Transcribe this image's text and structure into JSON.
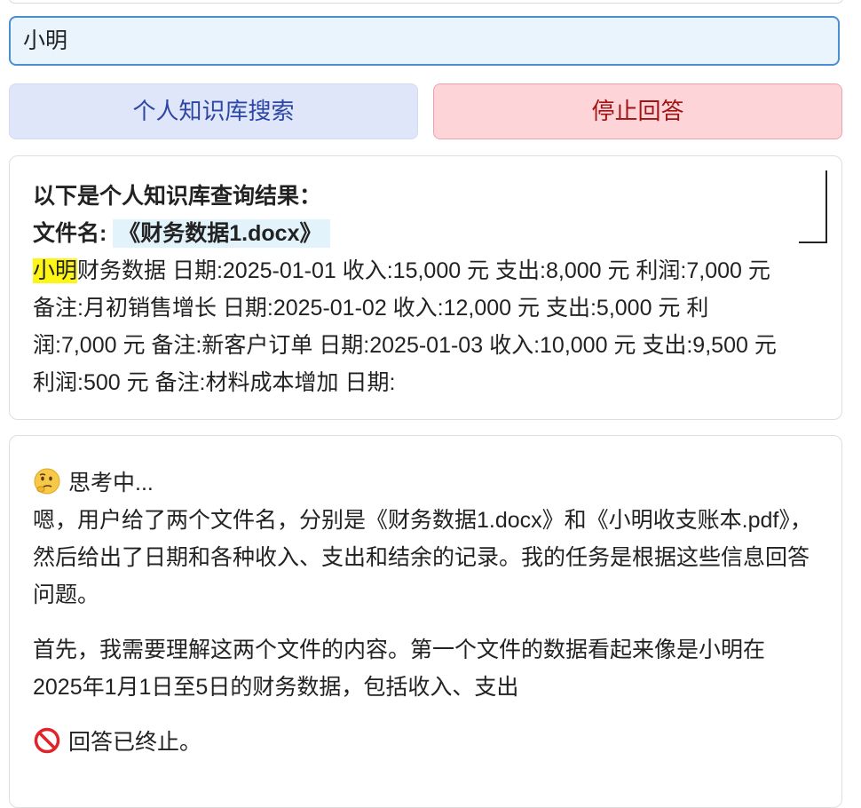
{
  "search": {
    "value": "小明"
  },
  "buttons": {
    "search_label": "个人知识库搜索",
    "stop_label": "停止回答"
  },
  "result": {
    "heading": "以下是个人知识库查询结果：",
    "filename_label": "文件名:",
    "filename": "《财务数据1.docx》",
    "highlight_term": "小明",
    "content": "财务数据 日期:2025-01-01 收入:15,000 元 支出:8,000 元 利润:7,000 元 备注:月初销售增长 日期:2025-01-02 收入:12,000 元 支出:5,000 元 利润:7,000 元 备注:新客户订单 日期:2025-01-03 收入:10,000 元 支出:9,500 元 利润:500 元 备注:材料成本增加 日期:"
  },
  "answer": {
    "thinking_icon": "thinking-face-icon",
    "thinking_label": "思考中...",
    "paragraph1": "嗯，用户给了两个文件名，分别是《财务数据1.docx》和《小明收支账本.pdf》，然后给出了日期和各种收入、支出和结余的记录。我的任务是根据这些信息回答问题。",
    "paragraph2": "首先，我需要理解这两个文件的内容。第一个文件的数据看起来像是小明在2025年1月1日至5日的财务数据，包括收入、支出",
    "stopped_icon": "prohibited-icon",
    "stopped_label": "回答已终止。"
  },
  "colors": {
    "input_border": "#4a8fd0",
    "input_bg": "#eaf4fd",
    "search_btn_bg": "#dfe6fa",
    "search_btn_text": "#2d46a6",
    "stop_btn_bg": "#fdd5d9",
    "stop_btn_text": "#a01414",
    "highlight": "#fdf516"
  }
}
